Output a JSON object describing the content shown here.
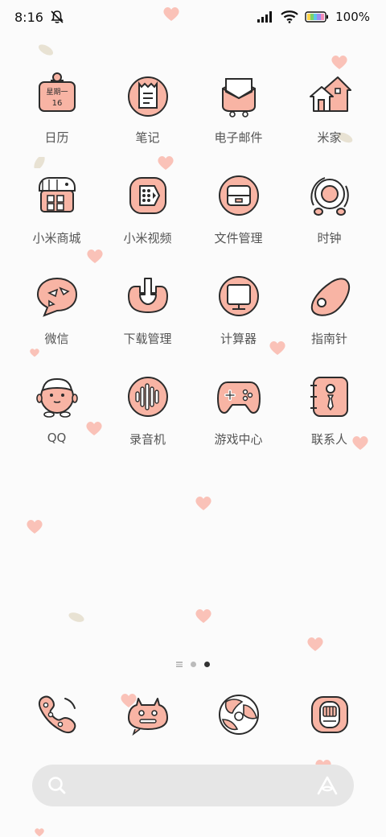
{
  "status_bar": {
    "time": "8:16",
    "battery_percent": "100%",
    "icons": [
      "bell-off-icon",
      "signal-icon",
      "wifi-icon",
      "battery-icon"
    ]
  },
  "colors": {
    "icon_fill": "#f8b4a4",
    "icon_stroke": "#2b2b2b",
    "heart": "#fac2b8",
    "label": "#555555"
  },
  "apps": [
    {
      "label": "日历",
      "icon": "calendar-icon",
      "calendar_top": "星期一",
      "calendar_day": "16"
    },
    {
      "label": "笔记",
      "icon": "notes-icon"
    },
    {
      "label": "电子邮件",
      "icon": "mail-icon"
    },
    {
      "label": "米家",
      "icon": "home-icon"
    },
    {
      "label": "小米商城",
      "icon": "store-icon"
    },
    {
      "label": "小米视频",
      "icon": "video-icon"
    },
    {
      "label": "文件管理",
      "icon": "folder-icon"
    },
    {
      "label": "时钟",
      "icon": "clock-icon"
    },
    {
      "label": "微信",
      "icon": "wechat-icon"
    },
    {
      "label": "下载管理",
      "icon": "download-icon"
    },
    {
      "label": "计算器",
      "icon": "calculator-icon"
    },
    {
      "label": "指南针",
      "icon": "compass-icon"
    },
    {
      "label": "QQ",
      "icon": "qq-icon"
    },
    {
      "label": "录音机",
      "icon": "recorder-icon"
    },
    {
      "label": "游戏中心",
      "icon": "gamepad-icon"
    },
    {
      "label": "联系人",
      "icon": "contacts-icon"
    }
  ],
  "page_indicator": {
    "pages": 3,
    "current": 3
  },
  "dock": [
    {
      "name": "phone",
      "icon": "phone-icon"
    },
    {
      "name": "messages",
      "icon": "message-icon"
    },
    {
      "name": "browser",
      "icon": "browser-icon"
    },
    {
      "name": "camera",
      "icon": "camera-icon"
    }
  ],
  "search": {
    "icon": "search-icon",
    "assistant_icon": "assistant-icon"
  }
}
